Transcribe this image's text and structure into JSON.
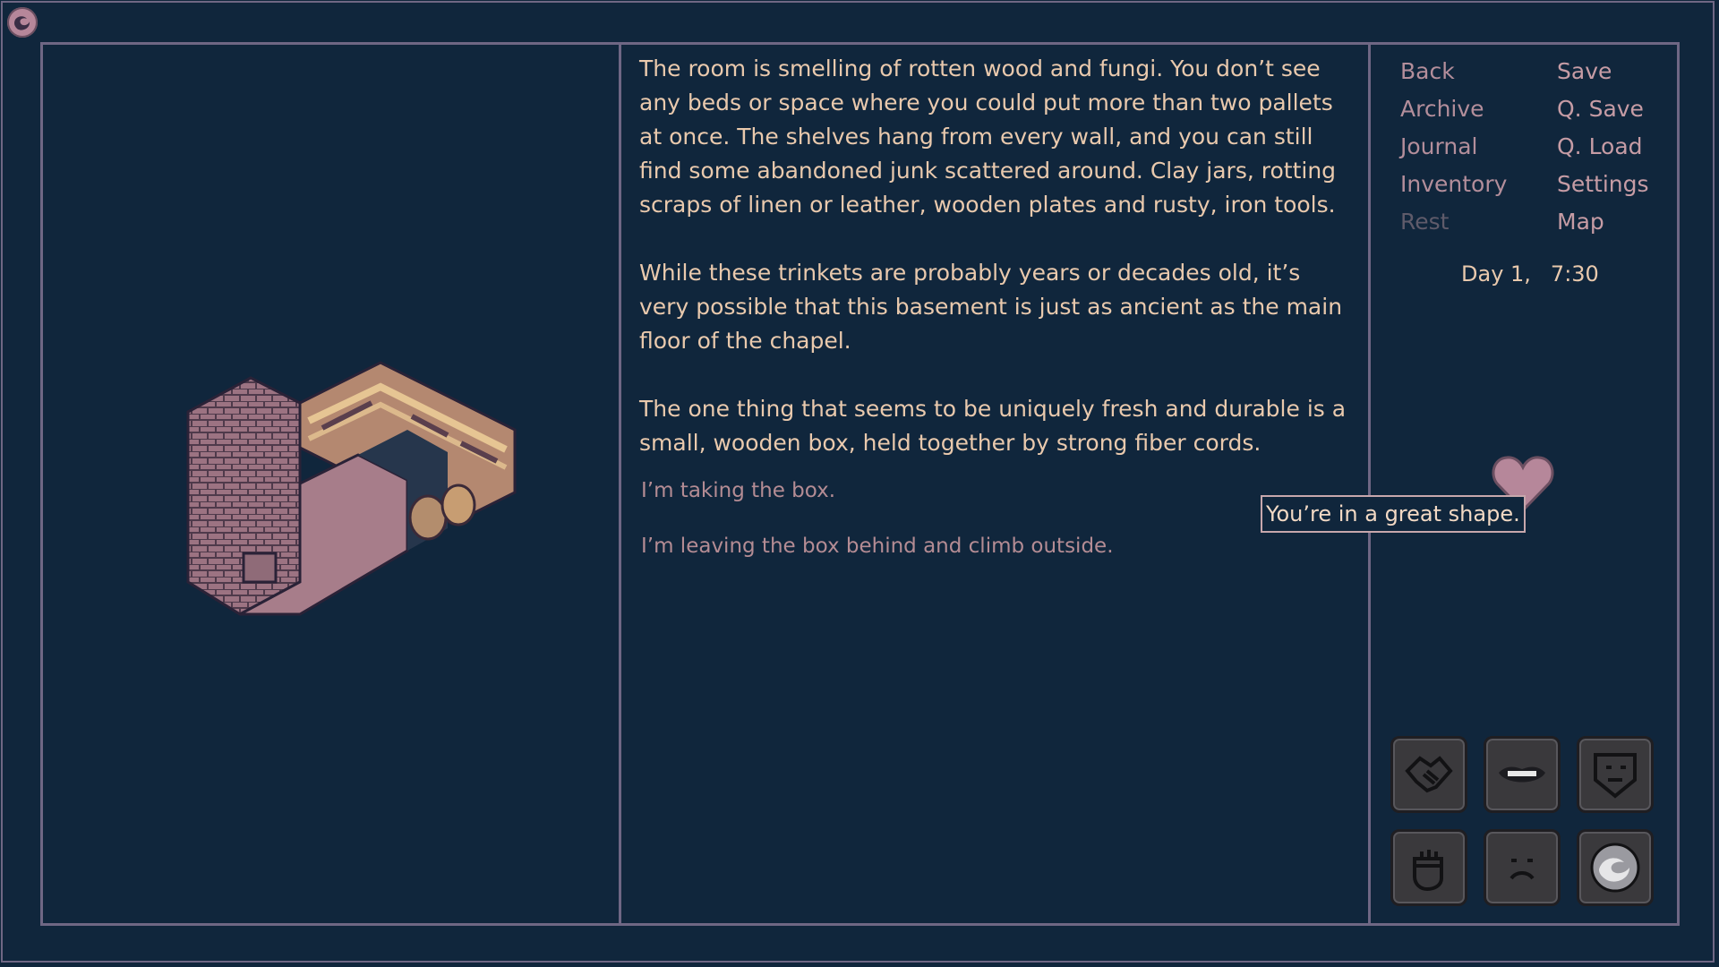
{
  "narrative": {
    "paragraphs": [
      "The room is smelling of rotten wood and fungi. You don’t see any beds or space where you could put more than two pallets at once. The shelves hang from every wall, and you can still find some abandoned junk scattered around. Clay jars, rotting scraps of linen or leather, wooden plates and rusty, iron tools.",
      "While these trinkets are probably years or decades old, it’s very possible that this basement is just as ancient as the main floor of the chapel.",
      "The one thing that seems to be uniquely fresh and durable is a small, wooden box, held together by strong fiber cords."
    ]
  },
  "choices": [
    "I’m taking the box.",
    "I’m leaving the box behind and climb outside."
  ],
  "menu": {
    "left": [
      "Back",
      "Archive",
      "Journal",
      "Inventory",
      "Rest"
    ],
    "right": [
      "Save",
      "Q. Save",
      "Q. Load",
      "Settings",
      "Map"
    ],
    "disabled": [
      "Rest"
    ]
  },
  "status": {
    "day": "Day 1,",
    "time": "7:30",
    "tooltip": "You’re in a great shape."
  },
  "stat_icons": [
    "handshake-icon",
    "lips-icon",
    "shield-face-icon",
    "fist-icon",
    "sad-face-icon",
    "orb-icon"
  ],
  "colors": {
    "background": "#10263c",
    "border": "#6f6784",
    "text": "#e9c9ad",
    "menu_text": "#b38e9b",
    "disabled_text": "#5f5b6a",
    "heart": "#b6879a"
  }
}
